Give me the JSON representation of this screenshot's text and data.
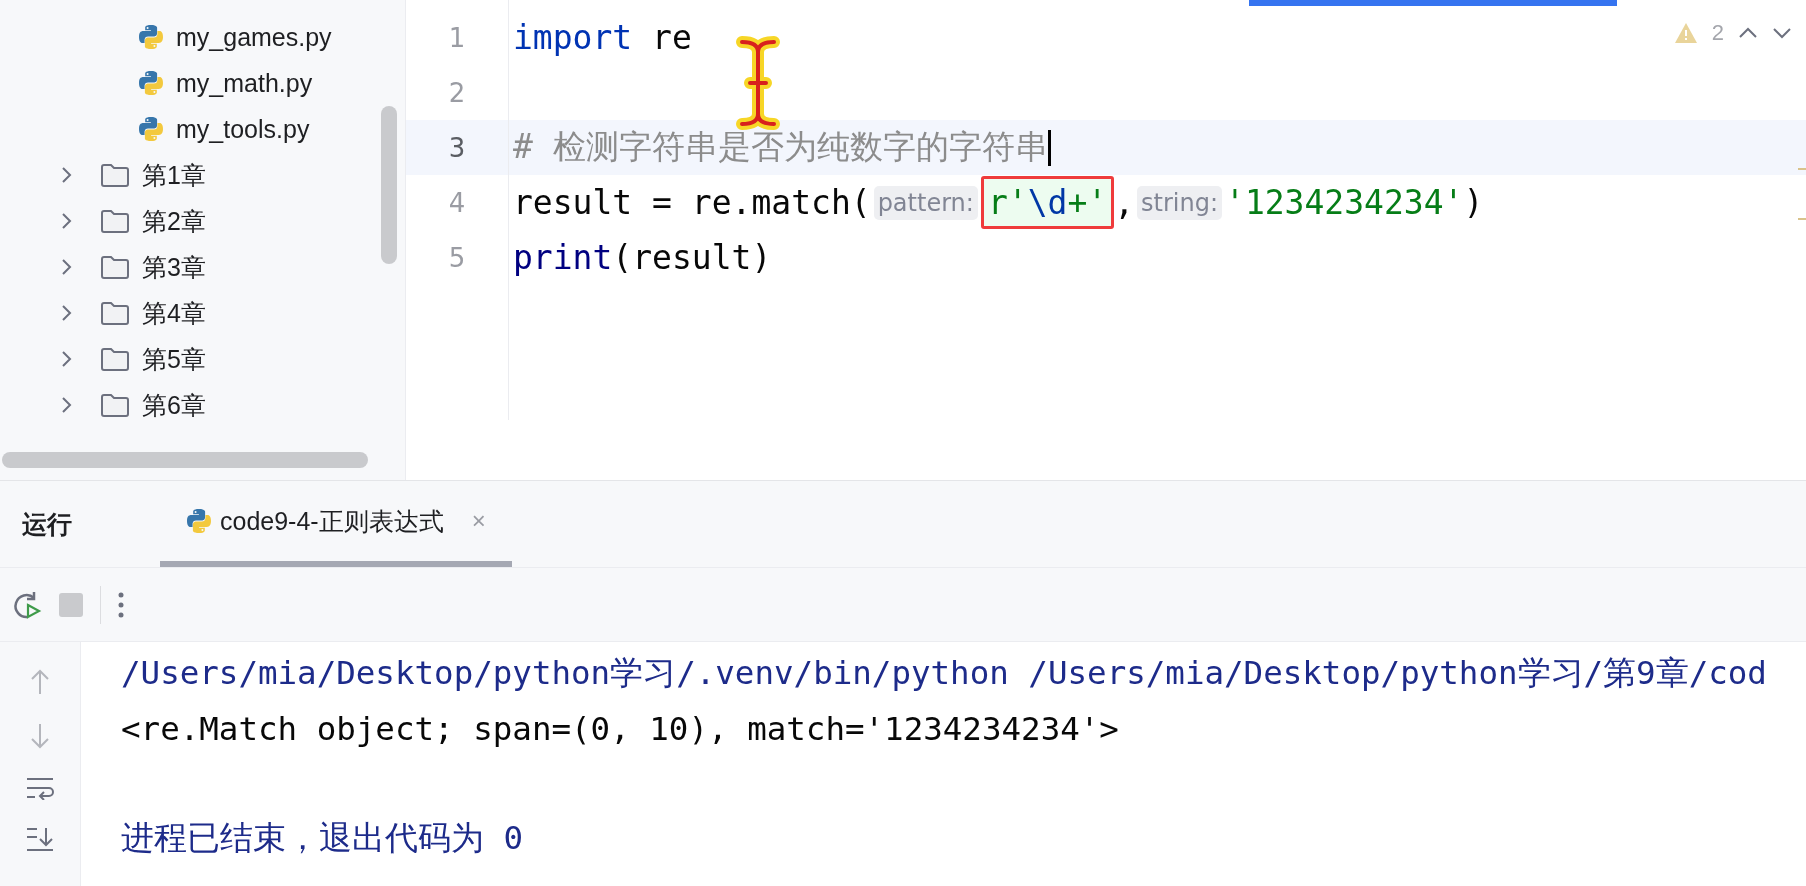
{
  "sidebar": {
    "items": [
      {
        "kind": "file",
        "label": "my_games.py"
      },
      {
        "kind": "file",
        "label": "my_math.py"
      },
      {
        "kind": "file",
        "label": "my_tools.py"
      },
      {
        "kind": "folder",
        "label": "第1章",
        "expanded": false
      },
      {
        "kind": "folder",
        "label": "第2章",
        "expanded": false
      },
      {
        "kind": "folder",
        "label": "第3章",
        "expanded": false
      },
      {
        "kind": "folder",
        "label": "第4章",
        "expanded": false
      },
      {
        "kind": "folder",
        "label": "第5章",
        "expanded": false
      },
      {
        "kind": "folder",
        "label": "第6章",
        "expanded": false
      }
    ]
  },
  "editor": {
    "top_tab": {
      "selected": true
    },
    "warnings": "2",
    "lines": [
      {
        "number": "1",
        "current": false,
        "tokens": [
          {
            "kind": "keyword",
            "text": "import"
          },
          {
            "kind": "plain",
            "text": " re"
          }
        ]
      },
      {
        "number": "2",
        "current": false
      },
      {
        "number": "3",
        "current": true,
        "caret": true,
        "tokens": [
          {
            "kind": "comment",
            "text": "# 检测字符串是否为纯数字的字符串"
          }
        ]
      },
      {
        "number": "4",
        "current": false,
        "tokens": [
          {
            "kind": "plain",
            "text": "result = re.match("
          },
          {
            "kind": "hint",
            "text": "pattern:"
          },
          {
            "kind": "boxed",
            "parts": [
              {
                "kind": "string",
                "text": "r'"
              },
              {
                "kind": "escape",
                "text": "\\d"
              },
              {
                "kind": "string",
                "text": "+'"
              }
            ]
          },
          {
            "kind": "plain",
            "text": ","
          },
          {
            "kind": "hint",
            "text": "string:"
          },
          {
            "kind": "string",
            "text": "'1234234234'"
          },
          {
            "kind": "plain",
            "text": ")"
          }
        ]
      },
      {
        "number": "5",
        "current": false,
        "tokens": [
          {
            "kind": "builtin",
            "text": "print"
          },
          {
            "kind": "plain",
            "text": "(result)"
          }
        ]
      }
    ]
  },
  "run_panel": {
    "title": "运行",
    "tabs": [
      {
        "label": "code9-4-正则表达式",
        "selected": true,
        "close": "×"
      }
    ],
    "console": [
      {
        "kind": "system",
        "text": "/Users/mia/Desktop/python学习/.venv/bin/python /Users/mia/Desktop/python学习/第9章/cod"
      },
      {
        "kind": "output",
        "text": "<re.Match object; span=(0, 10), match='1234234234'>"
      },
      {
        "kind": "blank"
      },
      {
        "kind": "system",
        "text": "进程已结束，退出代码为 0"
      }
    ]
  }
}
